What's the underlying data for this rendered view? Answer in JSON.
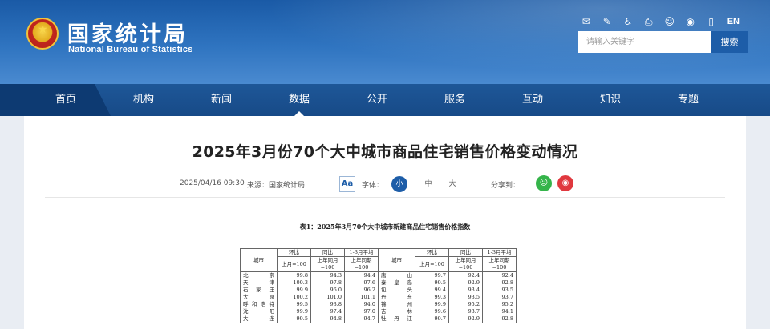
{
  "header": {
    "logo_cn": "国家统计局",
    "logo_en": "National Bureau of Statistics",
    "tool_icons": [
      "mail-icon",
      "message-icon",
      "accessibility-icon",
      "print-icon",
      "wechat-icon",
      "weibo-icon",
      "mobile-icon"
    ],
    "lang": "EN",
    "search_placeholder": "请输入关键字",
    "search_button": "搜索"
  },
  "nav": {
    "items": [
      "首页",
      "机构",
      "新闻",
      "数据",
      "公开",
      "服务",
      "互动",
      "知识",
      "专题"
    ],
    "active": "数据"
  },
  "article": {
    "title": "2025年3月份70个大中城市商品住宅销售价格变动情况",
    "date": "2025/04/16 09:30",
    "source": "来源：国家统计局",
    "sep": "|",
    "font_icon": "Aa",
    "font_label": "字体：",
    "font_sizes": [
      "小",
      "中",
      "大"
    ],
    "share_label": "分享到："
  },
  "table": {
    "caption": "表1：2025年3月70个大中城市新建商品住宅销售价格指数",
    "col_city": "城市",
    "col_mom": "环比",
    "col_yoy": "同比",
    "col_avg": "1-3月平均",
    "sub_mom": "上月=100",
    "sub_yoy_1": "上年同月",
    "sub_yoy_2": "=100",
    "sub_avg_1": "上年同期",
    "sub_avg_2": "=100",
    "rows": [
      [
        "北　　京",
        "99.8",
        "94.3",
        "94.4",
        "唐　　山",
        "99.7",
        "92.4",
        "92.4"
      ],
      [
        "天　　津",
        "100.3",
        "97.8",
        "97.6",
        "秦 皇 岛",
        "99.5",
        "92.9",
        "92.8"
      ],
      [
        "石 家 庄",
        "99.9",
        "96.0",
        "96.2",
        "包　　头",
        "99.4",
        "93.4",
        "93.5"
      ],
      [
        "太　　原",
        "100.2",
        "101.0",
        "101.1",
        "丹　　东",
        "99.3",
        "93.5",
        "93.7"
      ],
      [
        "呼和浩特",
        "99.5",
        "93.8",
        "94.0",
        "锦　　州",
        "99.9",
        "95.2",
        "95.2"
      ],
      [
        "沈　　阳",
        "99.9",
        "97.4",
        "97.0",
        "吉　　林",
        "99.6",
        "93.7",
        "94.1"
      ],
      [
        "大　　连",
        "99.5",
        "94.8",
        "94.7",
        "牡 丹 江",
        "99.7",
        "92.9",
        "92.8"
      ]
    ]
  }
}
